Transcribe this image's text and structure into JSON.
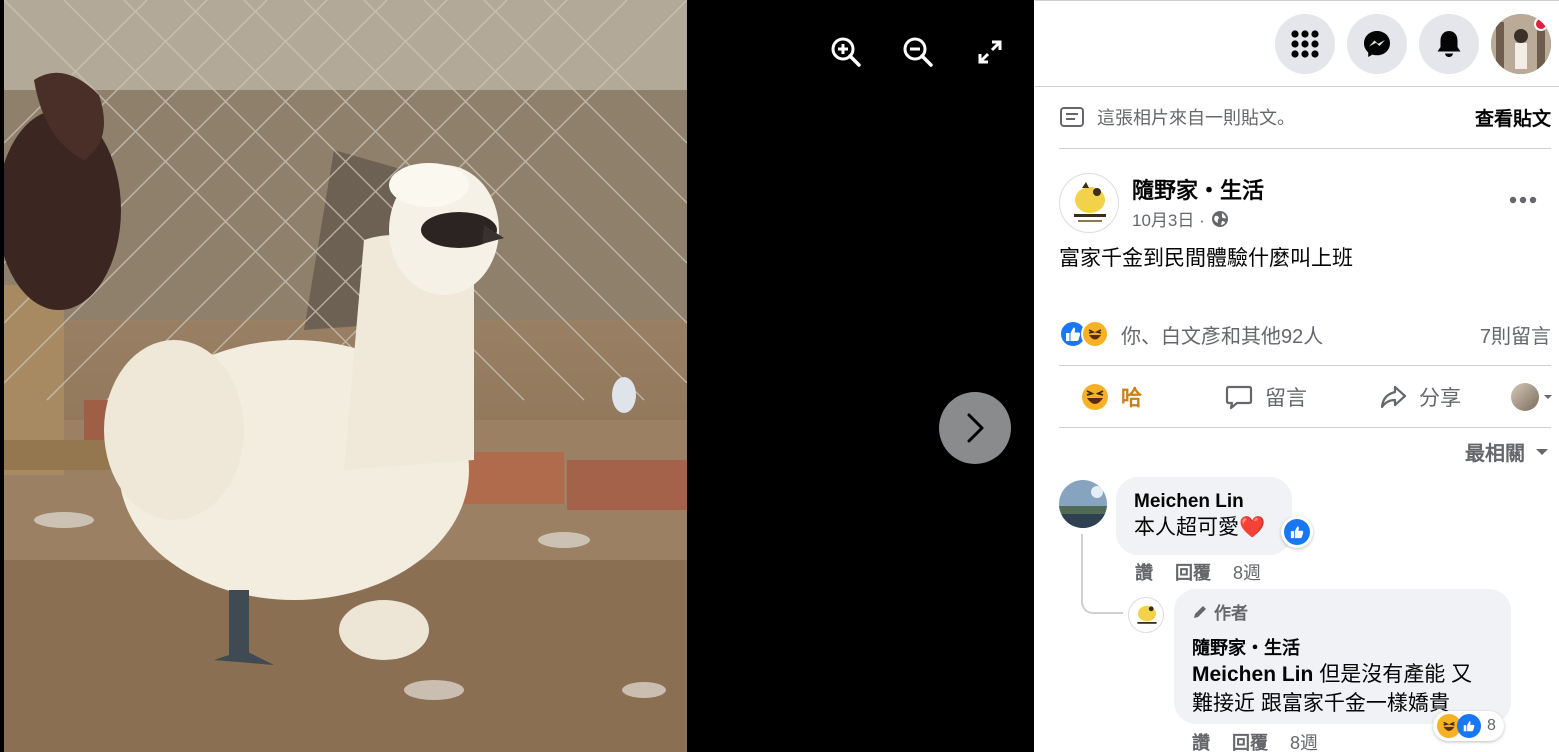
{
  "viewer": {
    "tools": [
      {
        "name": "zoom-in",
        "icon": "zoom-in-icon"
      },
      {
        "name": "zoom-out",
        "icon": "zoom-out-icon"
      },
      {
        "name": "fullscreen",
        "icon": "expand-icon"
      }
    ],
    "next_icon": "chevron-right-icon"
  },
  "topbar": {
    "buttons": [
      "menu-grid-icon",
      "messenger-icon",
      "bell-icon"
    ],
    "notification_dot_color": "#e41e3f"
  },
  "post": {
    "from_post_text": "這張相片來自一則貼文。",
    "view_post_label": "查看貼文",
    "page_name": "隨野家・生活",
    "date": "10月3日 ·",
    "privacy_icon": "globe-icon",
    "caption": "富家千金到民間體驗什麼叫上班",
    "reactions_text": "你、白文彥和其他92人",
    "comments_count": "7則留言",
    "actions": {
      "haha": "哈",
      "comment": "留言",
      "share": "分享"
    },
    "sort_label": "最相關"
  },
  "comments": [
    {
      "author": "Meichen Lin",
      "text": "本人超可愛❤️",
      "actions": {
        "like": "讚",
        "reply": "回覆",
        "time": "8週"
      }
    }
  ],
  "reply": {
    "badge": "作者",
    "author": "隨野家・生活",
    "mention": "Meichen Lin",
    "text": " 但是沒有產能 又難接近 跟富家千金一樣嬌貴",
    "reaction_count": "8",
    "actions": {
      "like": "讚",
      "reply": "回覆",
      "time": "8週"
    }
  },
  "colors": {
    "accent_blue": "#1877f2",
    "haha_yellow": "#f7b125",
    "haha_text": "#c9801a",
    "heart": "#e41e3f"
  }
}
